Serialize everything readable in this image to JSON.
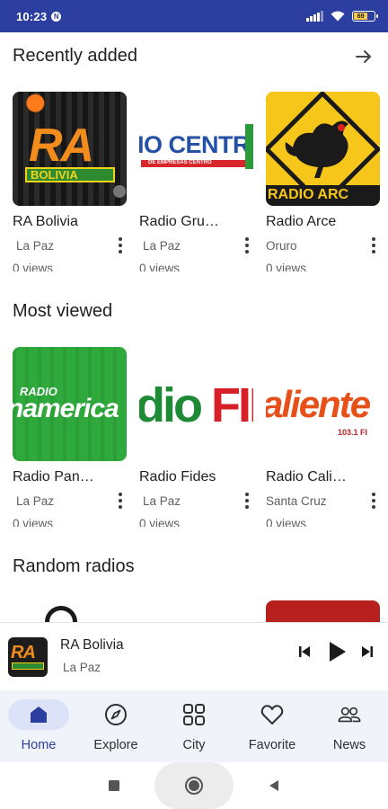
{
  "status_bar": {
    "time": "10:23",
    "notification_letter": "N",
    "battery": "69"
  },
  "sections": {
    "recently_added": {
      "title": "Recently added",
      "stations": [
        {
          "name": "RA Bolivia",
          "city": "La Paz",
          "views": "0 views",
          "logo": "ra-bolivia-logo"
        },
        {
          "name": "Radio Gru…",
          "city": "La Paz",
          "views": "0 views",
          "logo": "radio-grupo-centro-logo"
        },
        {
          "name": "Radio Arce",
          "city": "Oruro",
          "views": "0 views",
          "logo": "radio-arce-rooster-logo"
        }
      ]
    },
    "most_viewed": {
      "title": "Most viewed",
      "stations": [
        {
          "name": "Radio Pan…",
          "city": "La Paz",
          "views": "0 views",
          "logo": "radio-panamericana-logo"
        },
        {
          "name": "Radio Fides",
          "city": "La Paz",
          "views": "0 views",
          "logo": "radio-fides-logo"
        },
        {
          "name": "Radio Cali…",
          "city": "Santa Cruz",
          "views": "0 views",
          "logo": "radio-caliente-logo"
        }
      ]
    },
    "random_radios": {
      "title": "Random radios"
    }
  },
  "logos": {
    "ra_bolivia": {
      "big": "RA",
      "band": "BOLIVIA"
    },
    "grupo_centro": {
      "big": "IO CENTR",
      "small": "DE EMPRESAS CENTRO"
    },
    "arce": {
      "band": "RADIO ARC"
    },
    "panamericana": {
      "small": "RADIO",
      "big": "namerica"
    },
    "fides": {
      "big": "dio FID"
    },
    "caliente": {
      "big": "aliente",
      "small": "103.1 FI"
    }
  },
  "player": {
    "title": "RA Bolivia",
    "subtitle": "La Paz"
  },
  "nav": [
    {
      "label": "Home",
      "icon": "home-icon",
      "active": true
    },
    {
      "label": "Explore",
      "icon": "compass-icon",
      "active": false
    },
    {
      "label": "City",
      "icon": "grid-icon",
      "active": false
    },
    {
      "label": "Favorite",
      "icon": "heart-icon",
      "active": false
    },
    {
      "label": "News",
      "icon": "people-icon",
      "active": false
    }
  ],
  "colors": {
    "status_bar": "#2c3ea0",
    "nav_active_pill": "#dce3f9",
    "nav_active_icon": "#2c3ea0",
    "nav_background": "#f1f3fa"
  }
}
